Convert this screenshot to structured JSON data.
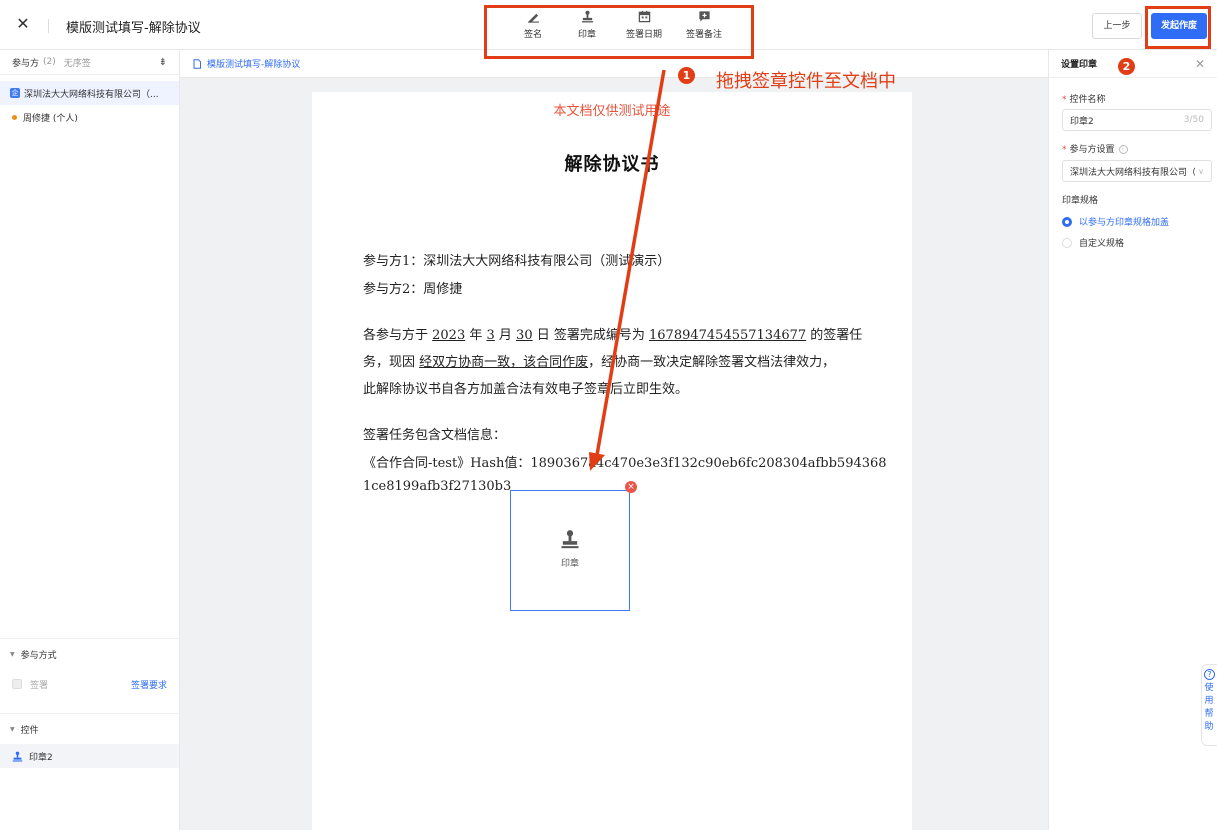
{
  "header": {
    "title": "模版测试填写-解除协议",
    "tools": [
      {
        "label": "签名",
        "icon": "pen-signature-icon"
      },
      {
        "label": "印章",
        "icon": "stamp-icon"
      },
      {
        "label": "签署日期",
        "icon": "calendar-icon"
      },
      {
        "label": "签署备注",
        "icon": "comment-plus-icon"
      }
    ],
    "prev_label": "上一步",
    "send_label": "发起作废"
  },
  "left": {
    "participants_label": "参与方",
    "participants_count": "(2)",
    "no_order_label": "无序签",
    "parties": [
      {
        "badge": "企",
        "name": "深圳法大大网络科技有限公司（..."
      },
      {
        "name": "周修捷 (个人)"
      }
    ],
    "participation_mode_label": "参与方式",
    "sign_label": "签署",
    "sign_requirement_label": "签署要求",
    "controls_label": "控件",
    "control_item": "印章2"
  },
  "center": {
    "breadcrumb": "模版测试填写-解除协议",
    "watermark": "本文档仅供测试用途",
    "doc_title": "解除协议书",
    "party1": "参与方1：深圳法大大网络科技有限公司（测试演示）",
    "party2": "参与方2：周修捷",
    "p1_a": "各参与方于 ",
    "year": "2023",
    "p1_b": " 年 ",
    "month": "3",
    "p1_c": " 月 ",
    "day": "30",
    "p1_d": " 日 签署完成编号为 ",
    "task_no": "1678947454557134677",
    "p1_e": " 的签署任",
    "p2_a": "务，现因 ",
    "reason": "经双方协商一致，该合同作废",
    "p2_b": "，经协商一致决定解除签署文档法律效力，",
    "p3": "此解除协议书自各方加盖合法有效电子签章后立即生效。",
    "docs_label": "签署任务包含文档信息：",
    "hash_line1": "《合作合同-test》Hash值：1890367a4c470e3e3f132c90eb6fc208304afbb594368",
    "hash_line2": "1ce8199afb3f27130b3",
    "seal_label": "印章",
    "seal_delete": "×"
  },
  "right": {
    "title": "设置印章",
    "control_name_label": "控件名称",
    "control_name_value": "印章2",
    "control_name_count": "3/50",
    "party_setting_label": "参与方设置",
    "party_setting_value": "深圳法大大网络科技有限公司（测",
    "seal_spec_label": "印章规格",
    "spec_options": [
      "以参与方印章规格加盖",
      "自定义规格"
    ],
    "help_text": "使用帮助"
  },
  "annotations": {
    "step1": "1",
    "step1_text": "拖拽签章控件至文档中",
    "step2": "2",
    "color": "#e23e16"
  }
}
